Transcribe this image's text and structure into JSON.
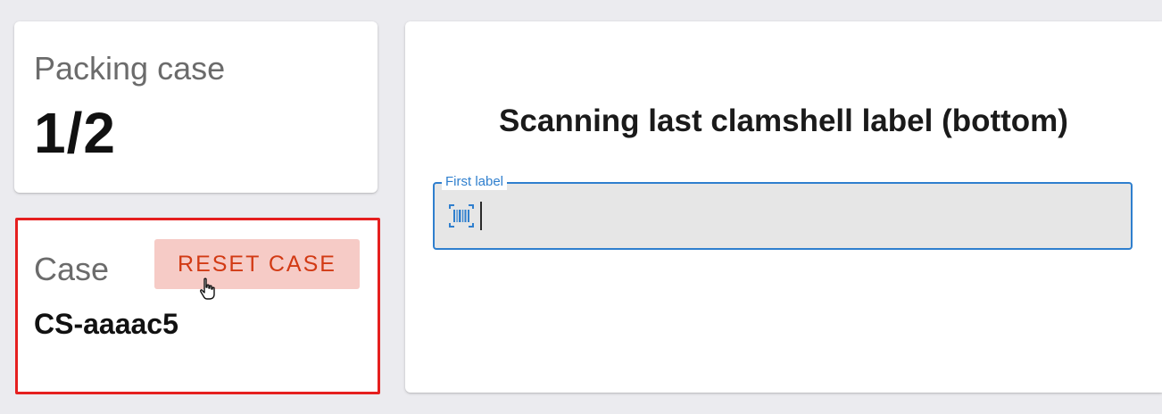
{
  "packing": {
    "label": "Packing case",
    "count": "1/2"
  },
  "case": {
    "label": "Case",
    "reset_label": "RESET CASE",
    "id": "CS-aaaac5"
  },
  "scan": {
    "title": "Scanning last clamshell label (bottom)",
    "field_label": "First label",
    "field_value": "",
    "icon": "barcode-scan-icon"
  },
  "colors": {
    "accent_blue": "#2f7fce",
    "reset_bg": "#f6cbc6",
    "reset_text": "#d23a14",
    "highlight_border": "#e51f1f"
  }
}
